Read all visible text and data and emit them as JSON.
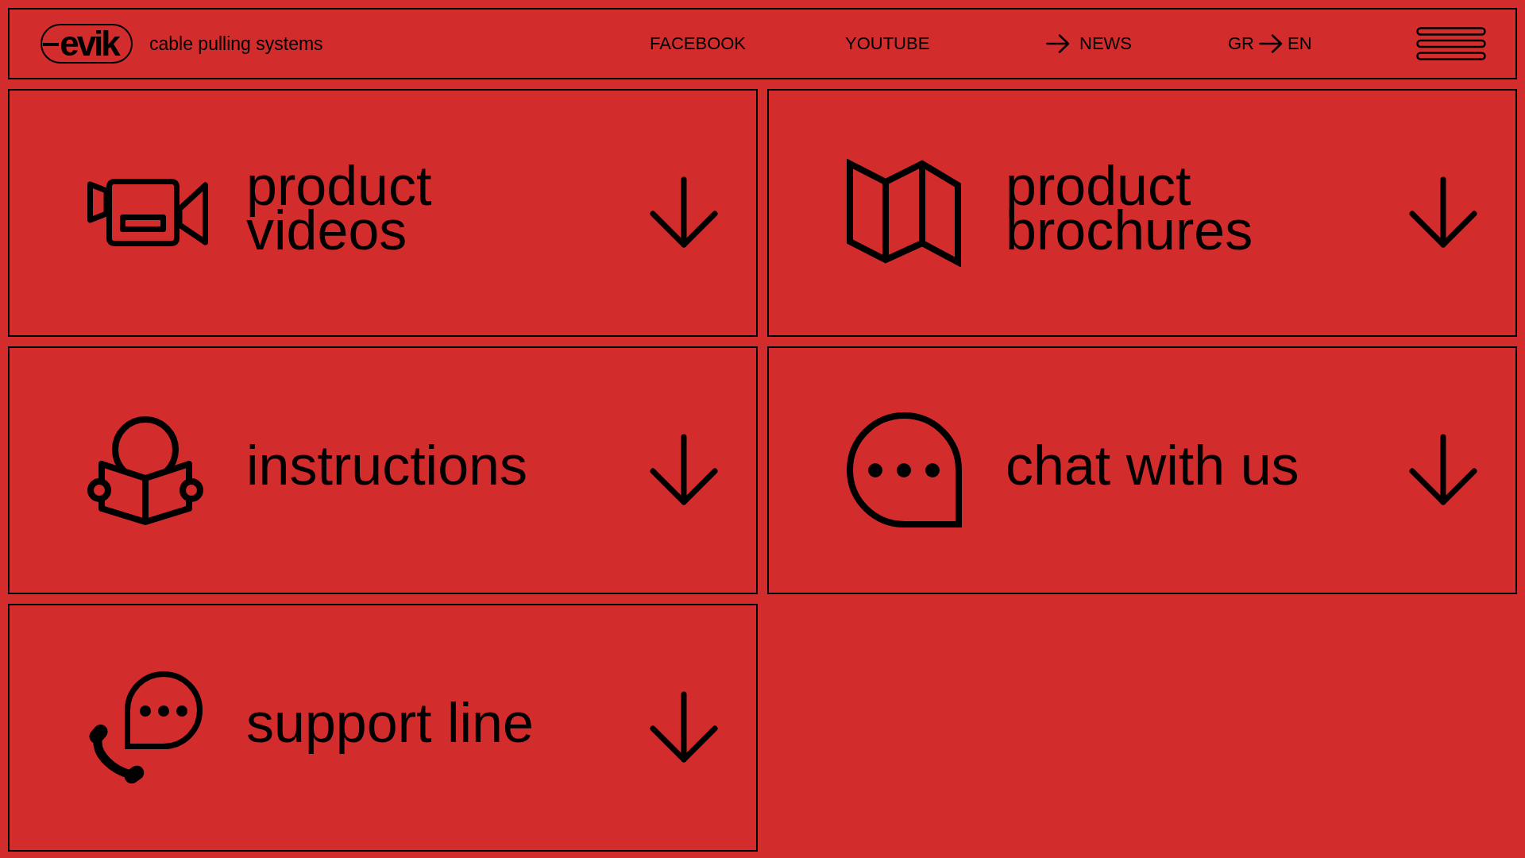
{
  "header": {
    "logo": "evik",
    "tagline": "cable pulling systems",
    "nav": [
      {
        "kind": "plain",
        "label": "FACEBOOK"
      },
      {
        "kind": "plain",
        "label": "YOUTUBE"
      },
      {
        "kind": "arrow",
        "label": "NEWS"
      }
    ],
    "language": [
      "GR",
      "EN"
    ]
  },
  "tiles": [
    {
      "kind": "video",
      "lines": [
        "product",
        "videos"
      ]
    },
    {
      "kind": "brochure",
      "lines": [
        "product",
        "brochures"
      ]
    },
    {
      "kind": "instructions",
      "lines": [
        "instructions"
      ]
    },
    {
      "kind": "chat",
      "lines": [
        "chat with us"
      ]
    },
    {
      "kind": "support",
      "lines": [
        "support line"
      ]
    }
  ]
}
